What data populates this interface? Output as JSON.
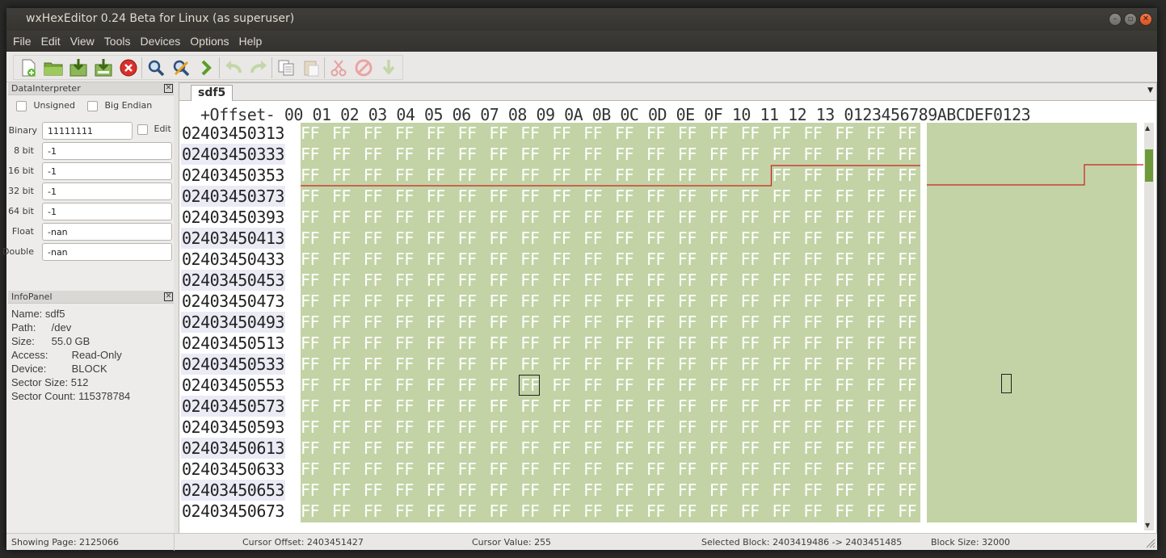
{
  "window": {
    "title": "wxHexEditor 0.24 Beta for Linux (as superuser)",
    "controls": [
      "minimize",
      "maximize",
      "close"
    ]
  },
  "menu": [
    "File",
    "Edit",
    "View",
    "Tools",
    "Devices",
    "Options",
    "Help"
  ],
  "toolbar": {
    "icons": [
      "new-file-icon",
      "open-folder-icon",
      "save-icon",
      "save-as-icon",
      "close-file-icon",
      "find-icon",
      "find-replace-icon",
      "goto-icon",
      "undo-icon",
      "redo-icon",
      "copy-icon",
      "paste-icon",
      "cut-icon",
      "delete-icon",
      "insert-icon"
    ]
  },
  "data_interpreter": {
    "title": "DataInterpreter",
    "unsigned_label": "Unsigned",
    "big_endian_label": "Big Endian",
    "binary_label": "Binary",
    "binary_value": "11111111",
    "edit_label": "Edit",
    "fields": [
      {
        "label": "8 bit",
        "value": "-1"
      },
      {
        "label": "16 bit",
        "value": "-1"
      },
      {
        "label": "32 bit",
        "value": "-1"
      },
      {
        "label": "64 bit",
        "value": "-1"
      },
      {
        "label": "Float",
        "value": "-nan"
      },
      {
        "label": "Double",
        "value": "-nan"
      }
    ]
  },
  "info_panel": {
    "title": "InfoPanel",
    "rows": [
      {
        "key": "Name:",
        "value": "sdf5"
      },
      {
        "key": "Path:",
        "value": "/dev"
      },
      {
        "key": "Size:",
        "value": "55.0 GB"
      },
      {
        "key": "Access:",
        "value": "Read-Only"
      },
      {
        "key": "Device:",
        "value": "BLOCK"
      },
      {
        "key": "Sector Size:",
        "value": "512"
      },
      {
        "key": "Sector Count:",
        "value": "115378784"
      }
    ]
  },
  "editor": {
    "tab": "sdf5",
    "header": "+Offset- 00 01 02 03 04 05 06 07 08 09 0A 0B 0C 0D 0E 0F 10 11 12 13 0123456789ABCDEF0123",
    "offsets": [
      "02403450313",
      "02403450333",
      "02403450353",
      "02403450373",
      "02403450393",
      "02403450413",
      "02403450433",
      "02403450453",
      "02403450473",
      "02403450493",
      "02403450513",
      "02403450533",
      "02403450553",
      "02403450573",
      "02403450593",
      "02403450613",
      "02403450633",
      "02403450653",
      "02403450673"
    ],
    "byte": "FF",
    "bytes_per_row": 20,
    "colors": {
      "selection_bg": "#c3d3a5",
      "byte_text": "#ffffff",
      "block_start_line": "#cc2020",
      "alt_offset_bg": "#ebebf6",
      "scroll_thumb": "#6e9a3c"
    }
  },
  "status": {
    "page": "Showing Page: 2125066",
    "cursor_offset": "Cursor Offset: 2403451427",
    "cursor_value": "Cursor Value: 255",
    "selected_block": "Selected Block: 2403419486 -> 2403451485",
    "block_size": "Block Size: 32000"
  }
}
